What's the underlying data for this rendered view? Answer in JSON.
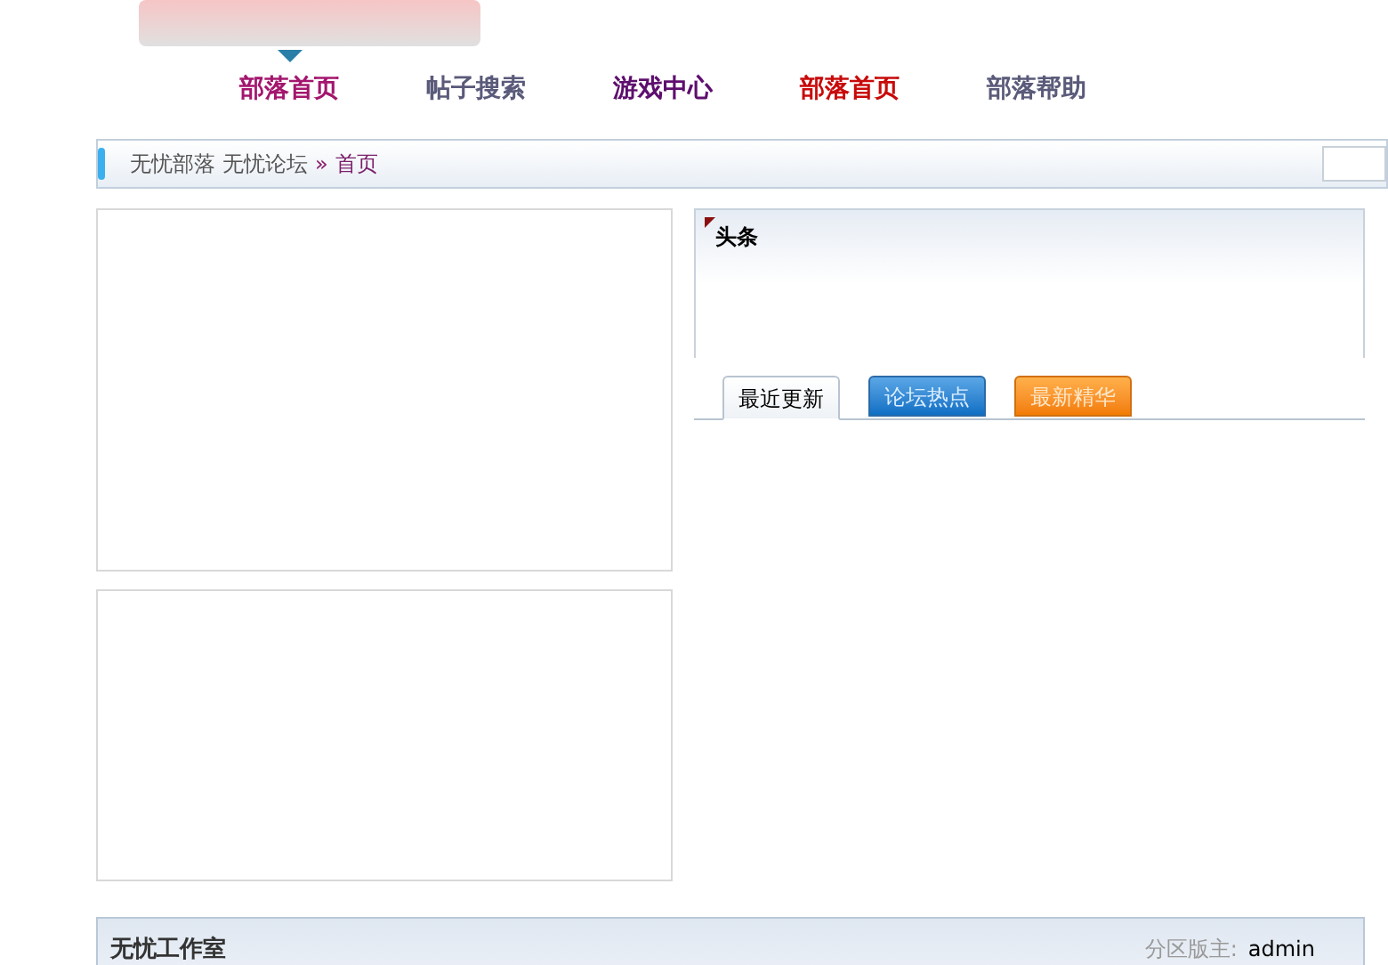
{
  "nav": [
    {
      "label": "部落首页",
      "selected": true,
      "color": "#a3166e"
    },
    {
      "label": "帖子搜索",
      "selected": false,
      "color": "#5a5a7a"
    },
    {
      "label": "游戏中心",
      "selected": false,
      "color": "#5e0e6e"
    },
    {
      "label": "部落首页",
      "selected": false,
      "color": "#c80a0a"
    },
    {
      "label": "部落帮助",
      "selected": false,
      "color": "#5a5a7a"
    }
  ],
  "breadcrumb": {
    "links": [
      "无忧部落",
      "无忧论坛"
    ],
    "separator": "»",
    "current": "首页"
  },
  "headline": {
    "title": "头条"
  },
  "tabs": [
    {
      "label": "最近更新",
      "kind": "plain",
      "selected": true
    },
    {
      "label": "论坛热点",
      "kind": "blue",
      "selected": false
    },
    {
      "label": "最新精华",
      "kind": "orange",
      "selected": false
    }
  ],
  "section": {
    "title": "无忧工作室",
    "moderator_label": "分区版主:",
    "moderator": "admin"
  }
}
